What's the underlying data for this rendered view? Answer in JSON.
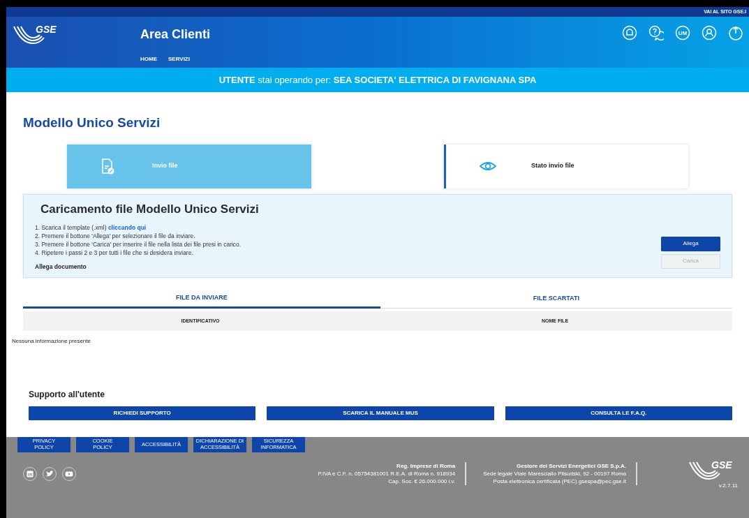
{
  "top_bar": {
    "link": "VAI AL SITO GSE.I"
  },
  "header": {
    "logo_text": "GSE",
    "title": "Area Clienti",
    "nav": [
      {
        "label": "HOME"
      },
      {
        "label": "SERVIZI"
      }
    ],
    "um_label": "UM"
  },
  "user_band": {
    "role": "UTENTE",
    "text": "stai operando per:",
    "company": "SEA SOCIETA' ELETTRICA DI FAVIGNANA SPA"
  },
  "page_title": "Modello Unico Servizi",
  "mode_cards": [
    {
      "kind": "upload",
      "label": "Invio file",
      "selected": true
    },
    {
      "kind": "status",
      "label": "Stato invio file",
      "selected": false
    }
  ],
  "upload_panel": {
    "title": "Caricamento file Modello Unico Servizi",
    "steps": [
      "1. Scarica il template (.xml) **cliccando qui**",
      "2. Premere il bottone 'Allega' per selezionare il file da inviare.",
      "3. Premere il bottone 'Carica' per inserire il file nella lista dei file presi in carico.",
      "4. Ripetere i passi 2 e 3 per tutti i file che si desidera inviare."
    ],
    "attach_label": "Allega documento",
    "buttons": [
      {
        "label": "Allega",
        "disabled": false
      },
      {
        "label": "Carica",
        "disabled": true
      }
    ]
  },
  "tabs": [
    {
      "label": "FILE DA INVIARE",
      "selected": true
    },
    {
      "label": "FILE SCARTATI",
      "selected": false
    }
  ],
  "table": {
    "columns": [
      "IDENTIFICATIVO",
      "NOME FILE"
    ],
    "empty_text": "Nessuna informazione presente"
  },
  "support": {
    "title": "Supporto all'utente",
    "buttons": [
      "RICHIEDI SUPPORTO",
      "SCARICA IL MANUALE MUS",
      "CONSULTA LE F.A.Q."
    ]
  },
  "footer": {
    "links": [
      [
        "PRIVACY",
        "POLICY"
      ],
      [
        "COOKIE",
        "POLICY"
      ],
      [
        "ACCESSIBILITÀ"
      ],
      [
        "DICHIARAZIONE DI",
        "ACCESSIBILITÀ"
      ],
      [
        "SICUREZZA",
        "INFORMATICA"
      ]
    ],
    "blocks": [
      {
        "lines": [
          "Reg. Imprese di Roma",
          "P.IVA e C.F. n. 05754381001 R.E.A. di Roma n. 918934",
          "Cap. Soc. € 26.000.000 i.v."
        ]
      },
      {
        "lines": [
          "Gestore dei Servizi Energetici GSE S.p.A.",
          "Sede legale Viale Maresciallo Pilsudski, 92 - 00197 Roma",
          "Posta elettronica certificata (PEC) gsespa@pec.gse.it"
        ]
      }
    ],
    "logo_text": "GSE",
    "version": "v.2.7.11"
  }
}
